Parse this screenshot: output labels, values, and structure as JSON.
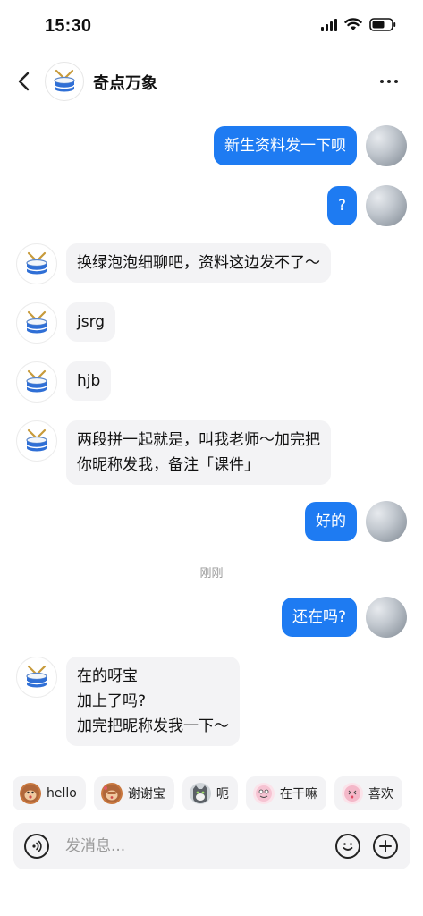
{
  "status_bar": {
    "time": "15:30"
  },
  "header": {
    "title": "奇点万象",
    "avatar_icon": "drum-icon"
  },
  "messages": [
    {
      "from": "me",
      "text": "新生资料发一下呗"
    },
    {
      "from": "me",
      "text": "?"
    },
    {
      "from": "them",
      "text": "换绿泡泡细聊吧，资料这边发不了～"
    },
    {
      "from": "them",
      "text": "jsrg"
    },
    {
      "from": "them",
      "text": "hjb"
    },
    {
      "from": "them",
      "text": "两段拼一起就是，叫我老师～加完把\n你昵称发我，备注「课件」"
    },
    {
      "from": "me",
      "text": "好的"
    },
    {
      "from": "me",
      "text": "还在吗?"
    },
    {
      "from": "them",
      "text": "在的呀宝\n加上了吗?\n加完把昵称发我一下～"
    }
  ],
  "timestamp": "刚刚",
  "quick_replies": [
    {
      "label": "hello",
      "icon": "monkey-emoji"
    },
    {
      "label": "谢谢宝",
      "icon": "monkey-emoji"
    },
    {
      "label": "呃",
      "icon": "cat-emoji"
    },
    {
      "label": "在干嘛",
      "icon": "sticker-emoji"
    },
    {
      "label": "喜欢",
      "icon": "sticker-emoji"
    }
  ],
  "input": {
    "placeholder": "发消息..."
  },
  "colors": {
    "accent": "#1e7bf2",
    "bubble_in": "#f3f3f5"
  }
}
